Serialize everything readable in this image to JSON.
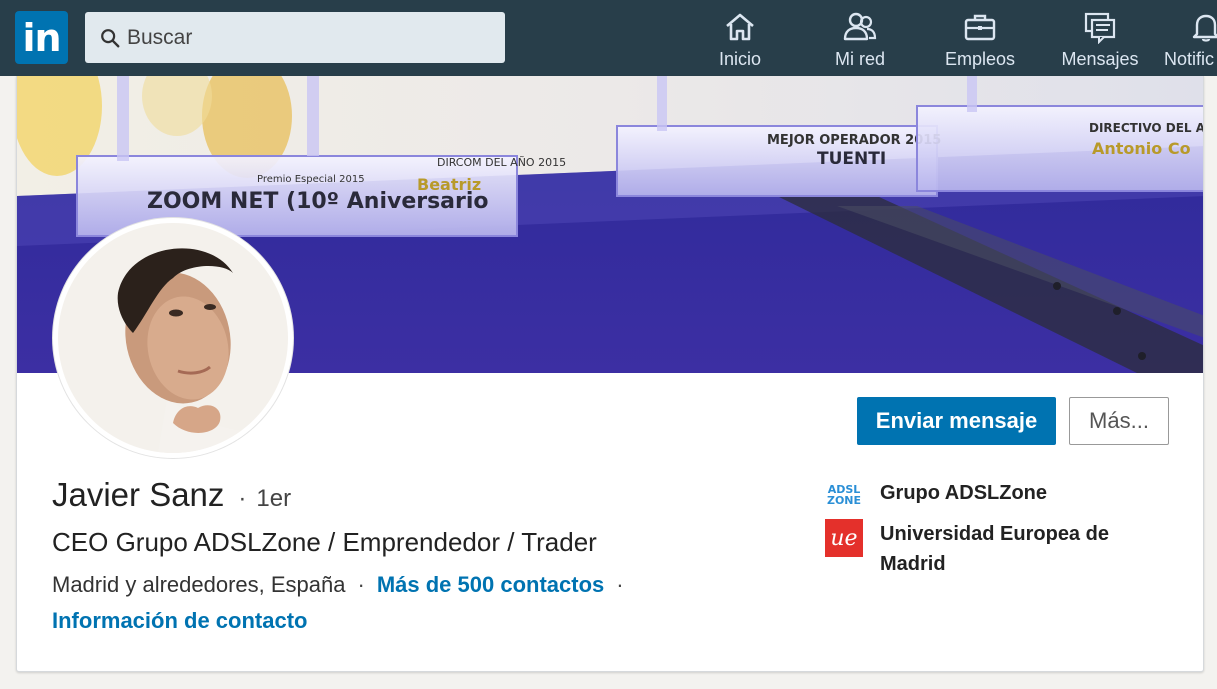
{
  "nav": {
    "logo": "in",
    "search_placeholder": "Buscar",
    "items": [
      {
        "label": "Inicio",
        "icon": "home-icon"
      },
      {
        "label": "Mi red",
        "icon": "people-icon"
      },
      {
        "label": "Empleos",
        "icon": "briefcase-icon"
      },
      {
        "label": "Mensajes",
        "icon": "messages-icon"
      },
      {
        "label": "Notific",
        "icon": "bell-icon"
      }
    ]
  },
  "banner": {
    "texts": [
      "ZOOM NET (10º Aniversario",
      "Premio Especial 2015",
      "DIRCOM DEL AÑO 2015",
      "Beatriz",
      "MEJOR OPERADOR 2015",
      "TUENTI",
      "DIRECTIVO DEL A",
      "Antonio Co"
    ]
  },
  "profile": {
    "name": "Javier Sanz",
    "separator": "·",
    "degree": "1er",
    "headline": "CEO Grupo ADSLZone / Emprendedor / Trader",
    "location": "Madrid y alrededores, España",
    "connections": "Más de 500 contactos",
    "contact_info": "Información de contacto"
  },
  "actions": {
    "message": "Enviar mensaje",
    "more": "Más..."
  },
  "orgs": [
    {
      "name": "Grupo ADSLZone",
      "logo_text": "ADSL ZONE"
    },
    {
      "name": "Universidad Europea de Madrid",
      "logo_text": "ue"
    }
  ],
  "colors": {
    "nav_bg": "#283e4a",
    "brand": "#0073b1",
    "ue_red": "#e4302b"
  }
}
